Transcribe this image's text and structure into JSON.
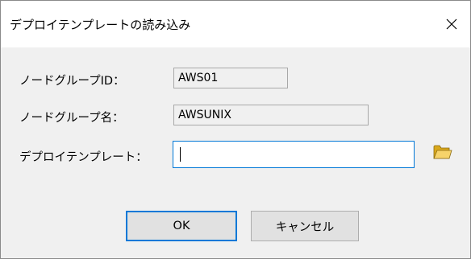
{
  "window": {
    "title": "デプロイテンプレートの読み込み",
    "close_glyph": "✕"
  },
  "form": {
    "node_group_id": {
      "label": "ノードグループID：",
      "value": "AWS01"
    },
    "node_group_name": {
      "label": "ノードグループ名：",
      "value": "AWSUNIX"
    },
    "deploy_template": {
      "label": "デプロイテンプレート：",
      "value": "",
      "browse_icon": "folder-open-icon"
    }
  },
  "buttons": {
    "ok_label": "OK",
    "cancel_label": "キャンセル"
  },
  "colors": {
    "accent": "#0078d7",
    "window_bg": "#f0f0f0",
    "titlebar_bg": "#ffffff",
    "button_bg": "#e1e1e1",
    "folder_yellow": "#f2c94c"
  }
}
